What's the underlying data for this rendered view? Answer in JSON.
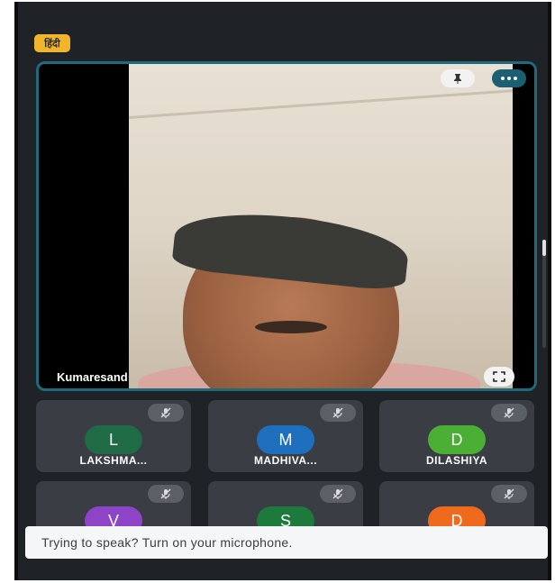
{
  "header": {
    "language_badge": "हिंदी",
    "badge_color": "#f0b52a"
  },
  "main_tile": {
    "name": "Kumaresand",
    "border_color": "#1f6b7d",
    "pin_icon": "pin-icon",
    "more_icon": "more-options-icon",
    "fullscreen_icon": "fullscreen-icon"
  },
  "participants": [
    {
      "initial": "L",
      "name": "LAKSHMA...",
      "color": "#1e6b46"
    },
    {
      "initial": "M",
      "name": "MADHIVA...",
      "color": "#1f6fbf"
    },
    {
      "initial": "D",
      "name": "DILASHIYA",
      "color": "#4caf35"
    },
    {
      "initial": "V",
      "name": "",
      "color": "#8e44c6"
    },
    {
      "initial": "S",
      "name": "",
      "color": "#1e7a3c"
    },
    {
      "initial": "D",
      "name": "",
      "color": "#f06a1d"
    }
  ],
  "toast": {
    "message": "Trying to speak? Turn on your microphone."
  }
}
